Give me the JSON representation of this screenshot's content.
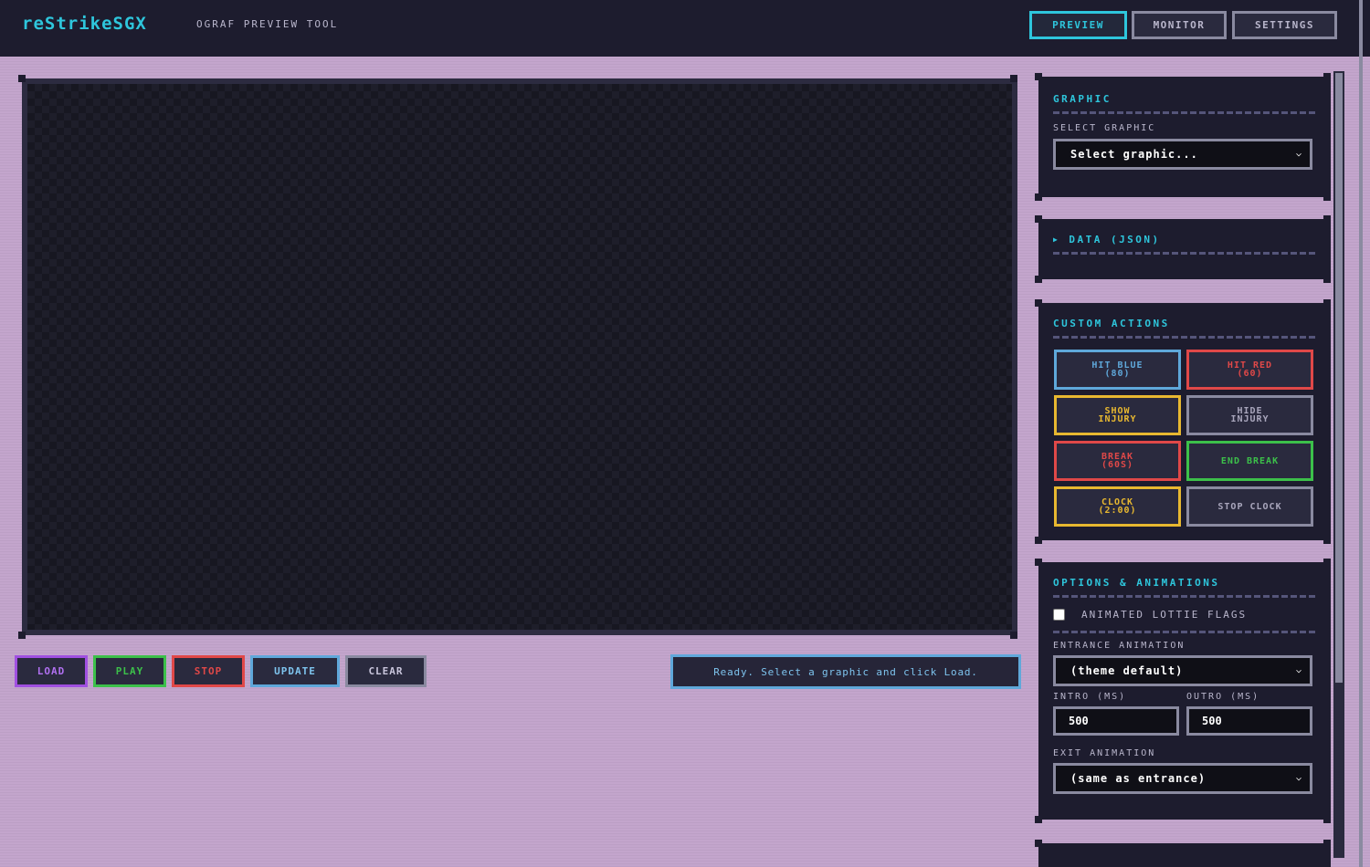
{
  "header": {
    "logo": "reStrikeSGX",
    "subtitle": "OGRAF PREVIEW TOOL",
    "nav": [
      {
        "label": "PREVIEW",
        "active": true
      },
      {
        "label": "MONITOR",
        "active": false
      },
      {
        "label": "SETTINGS",
        "active": false
      }
    ]
  },
  "controls": {
    "load": "LOAD",
    "play": "PLAY",
    "stop": "STOP",
    "update": "UPDATE",
    "clear": "CLEAR",
    "status": "Ready. Select a graphic and click Load."
  },
  "graphic_panel": {
    "title": "GRAPHIC",
    "select_label": "SELECT GRAPHIC",
    "select_value": "Select graphic..."
  },
  "data_panel": {
    "title": "DATA (JSON)",
    "toggle_glyph": "▶"
  },
  "actions_panel": {
    "title": "CUSTOM ACTIONS",
    "buttons": [
      {
        "label": "HIT BLUE\n(80)",
        "color": "#5fa8da"
      },
      {
        "label": "HIT RED\n(60)",
        "color": "#e04848"
      },
      {
        "label": "SHOW\nINJURY",
        "color": "#e8b830"
      },
      {
        "label": "HIDE\nINJURY",
        "color": "#8a8aa0"
      },
      {
        "label": "BREAK\n(60S)",
        "color": "#e04848"
      },
      {
        "label": "END BREAK",
        "color": "#3cc04a"
      },
      {
        "label": "CLOCK\n(2:00)",
        "color": "#e8b830"
      },
      {
        "label": "STOP CLOCK",
        "color": "#8a8aa0"
      }
    ]
  },
  "options_panel": {
    "title": "OPTIONS & ANIMATIONS",
    "lottie_label": "ANIMATED LOTTIE FLAGS",
    "entrance_label": "ENTRANCE ANIMATION",
    "entrance_value": "(theme default)",
    "intro_label": "INTRO (MS)",
    "intro_value": "500",
    "outro_label": "OUTRO (MS)",
    "outro_value": "500",
    "exit_label": "EXIT ANIMATION",
    "exit_value": "(same as entrance)"
  },
  "colors": {
    "accent": "#2ec6dc",
    "load": "#a050e0",
    "play": "#3cc04a",
    "stop": "#e04848",
    "update": "#5fa8da",
    "clear": "#8a8aa0"
  }
}
